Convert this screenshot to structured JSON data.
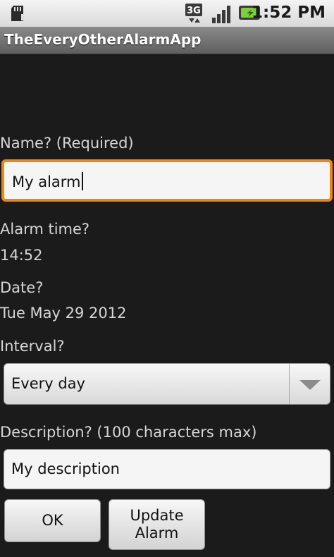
{
  "status_bar": {
    "icons": [
      "sd-card-icon",
      "3g-data-icon",
      "signal-strength-icon",
      "battery-charging-icon"
    ],
    "time": "1:52 PM"
  },
  "app": {
    "title": "TheEveryOtherAlarmApp"
  },
  "form": {
    "name_label": "Name? (Required)",
    "name_value": "My alarm",
    "alarm_time_label": "Alarm time?",
    "alarm_time_value": "14:52",
    "date_label": "Date?",
    "date_value": "Tue May 29 2012",
    "interval_label": "Interval?",
    "interval_selected": "Every day",
    "description_label": "Description? (100 characters max)",
    "description_value": "My description"
  },
  "buttons": {
    "ok_label": "OK",
    "update_label": "Update\nAlarm"
  },
  "colors": {
    "background": "#1b1b1b",
    "focus_border": "#f0860f",
    "label_text": "#d6d6d6",
    "title_bar": "#6e6e6e"
  }
}
